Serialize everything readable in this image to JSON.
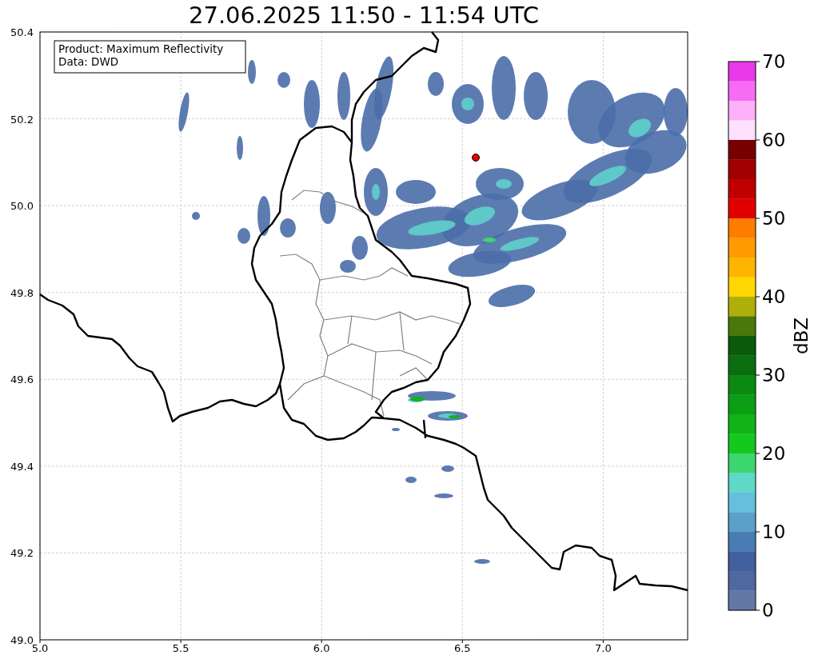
{
  "title": "27.06.2025 11:50 - 11:54 UTC",
  "map": {
    "info_box": [
      "Product: Maximum Reflectivity",
      "Data: DWD"
    ],
    "xticks": [
      "5.0",
      "5.5",
      "6.0",
      "6.5",
      "7.0"
    ],
    "yticks": [
      "50.4",
      "50.2",
      "50.0",
      "49.8",
      "49.6",
      "49.4",
      "49.2",
      "49.0"
    ]
  },
  "colorbar": {
    "label": "dBZ",
    "ticks": [
      "70",
      "60",
      "50",
      "40",
      "30",
      "20",
      "10",
      "0"
    ],
    "segments": [
      {
        "color": "#e838e8"
      },
      {
        "color": "#f76cf5"
      },
      {
        "color": "#ffb0fb"
      },
      {
        "color": "#ffe0ff"
      },
      {
        "color": "#780000"
      },
      {
        "color": "#a00000"
      },
      {
        "color": "#c00000"
      },
      {
        "color": "#e00000"
      },
      {
        "color": "#ff7c00"
      },
      {
        "color": "#ff9a00"
      },
      {
        "color": "#ffb400"
      },
      {
        "color": "#ffd700"
      },
      {
        "color": "#afaf0a"
      },
      {
        "color": "#4a780a"
      },
      {
        "color": "#0a5a0a"
      },
      {
        "color": "#0a6e10"
      },
      {
        "color": "#0a8a10"
      },
      {
        "color": "#0a9e14"
      },
      {
        "color": "#10b418"
      },
      {
        "color": "#14c81e"
      },
      {
        "color": "#3cd66e"
      },
      {
        "color": "#5fd8c8"
      },
      {
        "color": "#64c0dc"
      },
      {
        "color": "#5aa0c8"
      },
      {
        "color": "#4a7cb4"
      },
      {
        "color": "#4260a0"
      },
      {
        "color": "#5068a0"
      },
      {
        "color": "#6478a8"
      }
    ]
  }
}
